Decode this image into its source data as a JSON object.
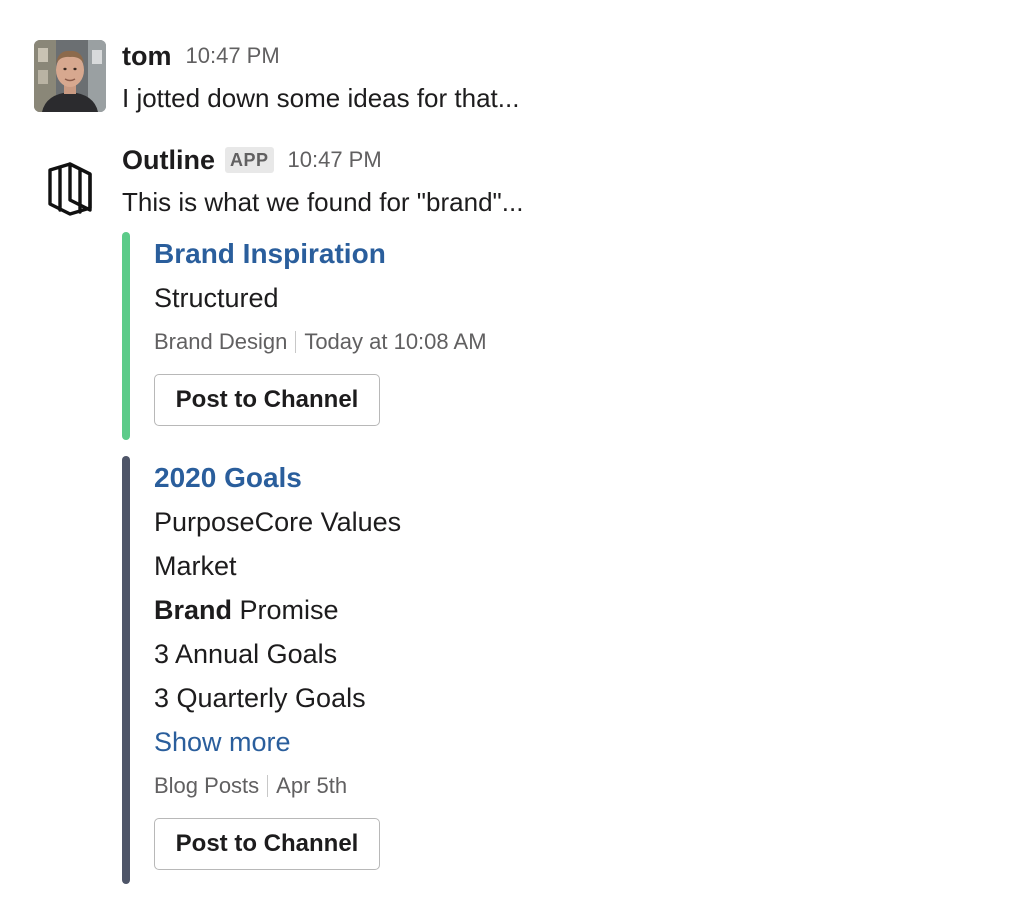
{
  "messages": [
    {
      "sender": "tom",
      "time": "10:47 PM",
      "text": "I jotted down some ideas for that..."
    },
    {
      "sender": "Outline",
      "badge": "APP",
      "time": "10:47 PM",
      "text": "This is what we found for \"brand\"..."
    }
  ],
  "attachments": [
    {
      "title": "Brand Inspiration",
      "lines": [
        "Structured"
      ],
      "collection": "Brand Design",
      "updated": "Today at 10:08 AM",
      "button_label": "Post to Channel",
      "bar_color": "#5ccb89"
    },
    {
      "title": "2020 Goals",
      "lines": [
        "PurposeCore Values",
        "Market",
        "Brand",
        "Promise",
        "3 Annual Goals",
        "3 Quarterly Goals"
      ],
      "show_more": "Show more",
      "collection": "Blog Posts",
      "updated": "Apr 5th",
      "button_label": "Post to Channel",
      "bar_color": "#4e5568"
    }
  ],
  "icons": {
    "tom_avatar": "user-avatar-photo",
    "outline_avatar": "outline-logo-icon"
  },
  "colors": {
    "link": "#2a5e9c",
    "muted": "#616061",
    "text": "#1d1c1d"
  }
}
